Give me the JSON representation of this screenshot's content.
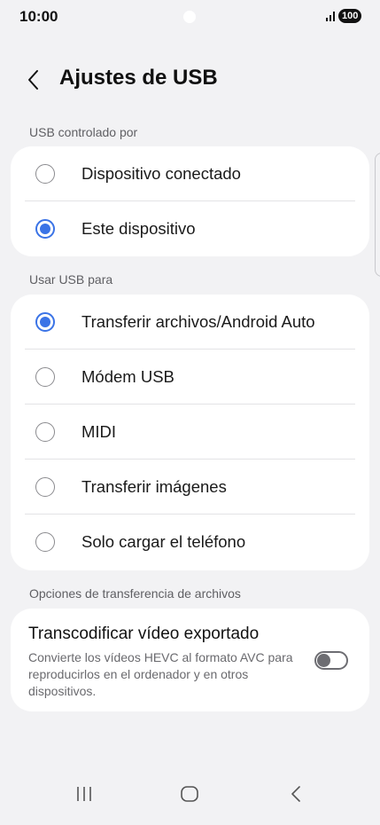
{
  "status_bar": {
    "time": "10:00",
    "battery": "100",
    "icons": [
      "camera-cutout",
      "signal-icon",
      "battery-icon"
    ]
  },
  "header": {
    "back_icon": "chevron-left-icon",
    "title": "Ajustes de USB"
  },
  "usb_controlled_by": {
    "label": "USB controlado por",
    "options": [
      {
        "label": "Dispositivo conectado",
        "selected": false
      },
      {
        "label": "Este dispositivo",
        "selected": true
      }
    ]
  },
  "usb_use": {
    "label": "Usar USB para",
    "options": [
      {
        "label": "Transferir archivos/Android Auto",
        "selected": true
      },
      {
        "label": "Módem USB",
        "selected": false
      },
      {
        "label": "MIDI",
        "selected": false
      },
      {
        "label": "Transferir imágenes",
        "selected": false
      },
      {
        "label": "Solo cargar el teléfono",
        "selected": false
      }
    ]
  },
  "transfer_options": {
    "label": "Opciones de transferencia de archivos",
    "transcode_title": "Transcodificar vídeo exportado",
    "transcode_desc": "Convierte los vídeos HEVC al formato AVC para reproducirlos en el ordenador y en otros dispositivos.",
    "transcode_enabled": false
  },
  "nav_bar": {
    "icons": [
      "recent-apps-icon",
      "home-icon",
      "back-icon"
    ]
  },
  "colors": {
    "accent": "#3a73e6",
    "background": "#f2f2f4",
    "card": "#ffffff"
  }
}
